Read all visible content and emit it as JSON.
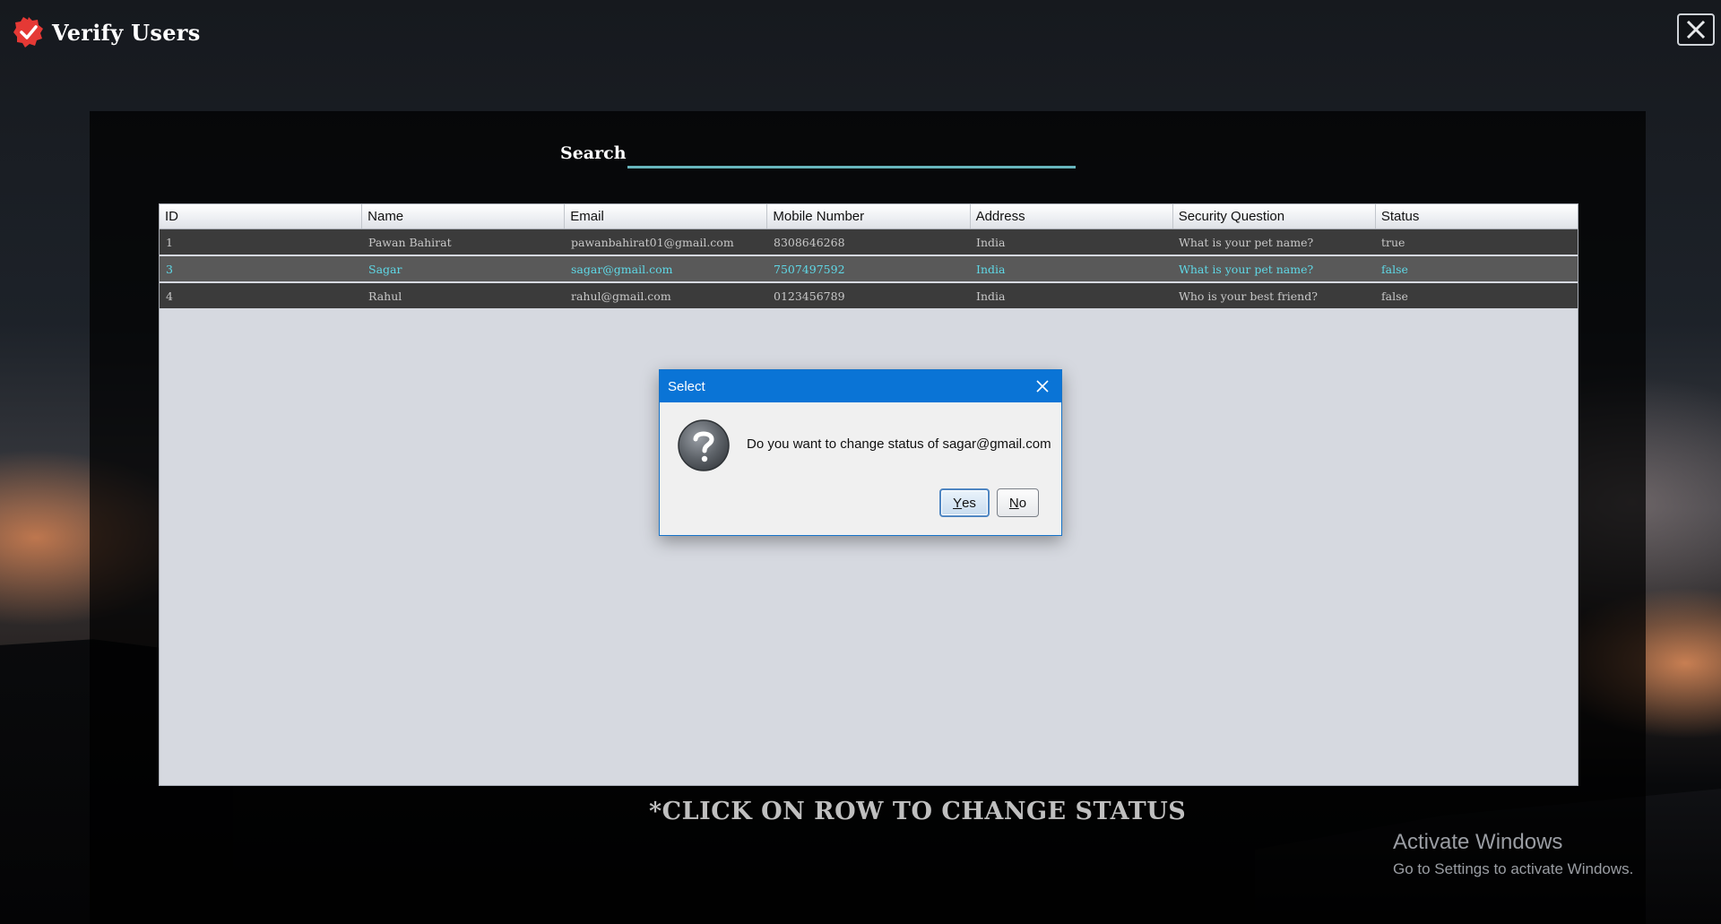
{
  "app": {
    "title": "Verify Users"
  },
  "search": {
    "label": "Search",
    "value": ""
  },
  "table": {
    "columns": [
      "ID",
      "Name",
      "Email",
      "Mobile Number",
      "Address",
      "Security Question",
      "Status"
    ],
    "rows": [
      {
        "id": "1",
        "name": "Pawan Bahirat",
        "email": "pawanbahirat01@gmail.com",
        "mobile": "8308646268",
        "address": "India",
        "question": "What is your pet name?",
        "status": "true",
        "selected": false
      },
      {
        "id": "3",
        "name": "Sagar",
        "email": "sagar@gmail.com",
        "mobile": "7507497592",
        "address": "India",
        "question": "What is your pet name?",
        "status": "false",
        "selected": true
      },
      {
        "id": "4",
        "name": "Rahul",
        "email": "rahul@gmail.com",
        "mobile": "0123456789",
        "address": "India",
        "question": "Who is your best friend?",
        "status": "false",
        "selected": false
      }
    ]
  },
  "footer_hint": "*CLICK ON ROW TO CHANGE STATUS",
  "dialog": {
    "title": "Select",
    "message": "Do you want to change status of sagar@gmail.com",
    "yes_mnemonic": "Y",
    "yes_rest": "es",
    "no_mnemonic": "N",
    "no_rest": "o"
  },
  "watermark": {
    "title": "Activate Windows",
    "subtitle": "Go to Settings to activate Windows."
  },
  "icons": {
    "app": "verified-badge-icon",
    "close": "close-icon",
    "dialog_close": "close-icon",
    "question": "question-icon"
  },
  "colors": {
    "accent": "#67b5bd",
    "selected_text": "#5fd8e6",
    "dialog_titlebar": "#0a74d6",
    "badge_red": "#e53935"
  }
}
